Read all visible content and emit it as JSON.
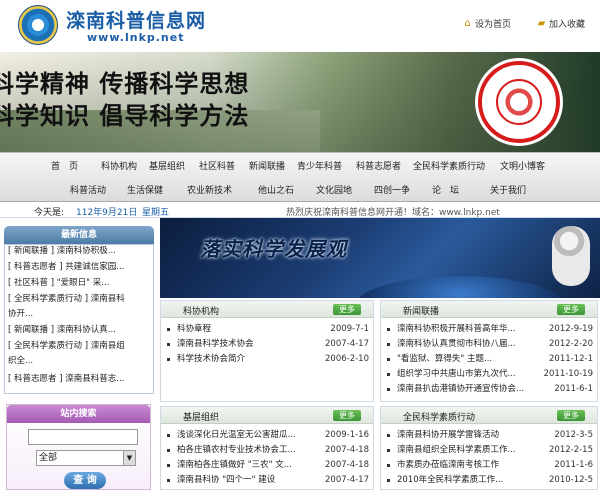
{
  "header": {
    "title": "滦南科普信息网",
    "url": "www.lnkp.net",
    "set_home": "设为首页",
    "add_fav": "加入收藏"
  },
  "banner": {
    "line1": "科学精神  传播科学思想",
    "line2": "科学知识  倡导科学方法"
  },
  "nav": {
    "row1": [
      "首　页",
      "科协机构",
      "基层组织",
      "社区科普",
      "新闻联播",
      "青少年科普",
      "科普志愿者",
      "全民科学素质行动",
      "文明小博客"
    ],
    "row2": [
      "科普活动",
      "生活保健",
      "农业新技术",
      "他山之石",
      "文化园地",
      "四创一争",
      "论　坛",
      "关于我们"
    ]
  },
  "infobar": {
    "today_label": "今天是:",
    "date": "112年9月21日",
    "weekday": "星期五",
    "marquee": "热烈庆祝滦南科普信息网开通！域名：www.lnkp.net"
  },
  "left": {
    "news_title": "最新信息",
    "news": [
      "[ 新闻联播 ]  滦南科协积极...",
      "[ 科普志愿者 ]  共建诚信家园...",
      "[ 社区科普 ]  \"爱眼日\" 采...",
      "[ 全民科学素质行动 ]  滦南县科",
      "协开...",
      "[ 新闻联播 ]  滦南科协认真...",
      "[ 全民科学素质行动 ]  滦南县组",
      "织全...",
      "[ 科普志愿者 ]  滦南县科普志..."
    ],
    "search_title": "站内搜索",
    "search_placeholder": "",
    "search_option": "全部",
    "search_button": "查 询"
  },
  "feature": {
    "slogan": "落实科学发展观"
  },
  "panels": {
    "p1": {
      "title": "科协机构",
      "more": "更多",
      "rows": [
        {
          "t": "科协章程",
          "d": "2009-7-1"
        },
        {
          "t": "滦南县科学技术协会",
          "d": "2007-4-17"
        },
        {
          "t": "科学技术协会简介",
          "d": "2006-2-10"
        }
      ]
    },
    "p2": {
      "title": "新闻联播",
      "more": "更多",
      "rows": [
        {
          "t": "滦南科协积极开展科普高年华...",
          "d": "2012-9-19"
        },
        {
          "t": "滦南科协认真贯彻市科协八届...",
          "d": "2012-2-20"
        },
        {
          "t": "\"看监狱、算得失\" 主题...",
          "d": "2011-12-1"
        },
        {
          "t": "组织学习中共唐山市第九次代...",
          "d": "2011-10-19"
        },
        {
          "t": "滦南县扒齿港镇协开通宣传协会...",
          "d": "2011-6-1"
        }
      ]
    },
    "p3": {
      "title": "基层组织",
      "more": "更多",
      "rows": [
        {
          "t": "浅谈深化日光温室无公害甜瓜...",
          "d": "2009-1-16"
        },
        {
          "t": "柏各庄镇农村专业技术协会工...",
          "d": "2007-4-18"
        },
        {
          "t": "滦南柏各庄镇做好 \"三农\" 文...",
          "d": "2007-4-18"
        },
        {
          "t": "滦南县科协 \"四个一\" 建设",
          "d": "2007-4-17"
        }
      ]
    },
    "p4": {
      "title": "全民科学素质行动",
      "more": "更多",
      "rows": [
        {
          "t": "滦南县科协开展学雷锋活动",
          "d": "2012-3-5"
        },
        {
          "t": "滦南县组织全民科学素质工作...",
          "d": "2012-2-15"
        },
        {
          "t": "市素质办莅临滦南考核工作",
          "d": "2011-1-6"
        },
        {
          "t": "2010年全民科学素质工作...",
          "d": "2010-12-5"
        }
      ]
    }
  }
}
